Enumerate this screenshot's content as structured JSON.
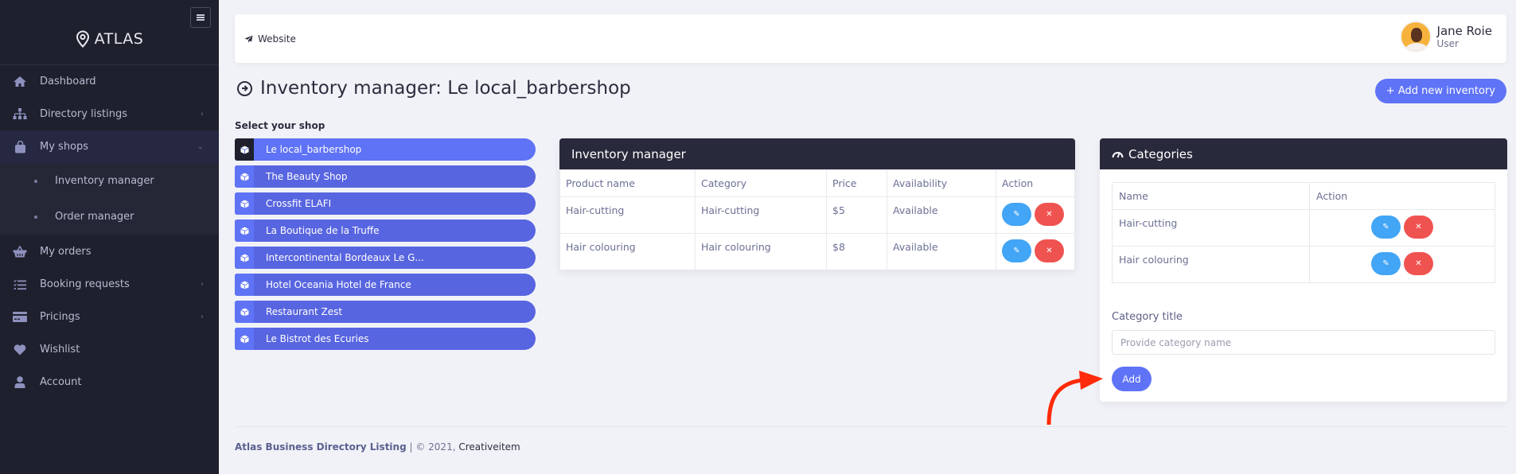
{
  "sidebar": {
    "brand": "ATLAS",
    "menu": [
      {
        "label": "Dashboard",
        "icon": "home-icon"
      },
      {
        "label": "Directory listings",
        "icon": "sitemap-icon"
      },
      {
        "label": "My shops",
        "icon": "shopping-bag-icon"
      },
      {
        "label": "My orders",
        "icon": "basket-icon"
      },
      {
        "label": "Booking requests",
        "icon": "tasks-icon"
      },
      {
        "label": "Pricings",
        "icon": "credit-card-icon"
      },
      {
        "label": "Wishlist",
        "icon": "heart-icon"
      },
      {
        "label": "Account",
        "icon": "user-icon"
      }
    ],
    "submenu": [
      {
        "label": "Inventory manager"
      },
      {
        "label": "Order manager"
      }
    ]
  },
  "topbar": {
    "website_label": "Website",
    "user_name": "Jane Roie",
    "user_role": "User"
  },
  "page": {
    "title": "Inventory manager: Le local_barbershop",
    "add_inventory_label": "+ Add new inventory",
    "select_shop_label": "Select your shop"
  },
  "shops": [
    {
      "name": "Le local_barbershop",
      "active": true
    },
    {
      "name": "The Beauty Shop"
    },
    {
      "name": "Crossfit ELAFI"
    },
    {
      "name": "La Boutique de la Truffe"
    },
    {
      "name": "Intercontinental Bordeaux Le G..."
    },
    {
      "name": "Hotel Oceania Hotel de France"
    },
    {
      "name": "Restaurant Zest"
    },
    {
      "name": "Le Bistrot des Ecuries"
    }
  ],
  "inventory": {
    "title": "Inventory manager",
    "columns": [
      "Product name",
      "Category",
      "Price",
      "Availability",
      "Action"
    ],
    "rows": [
      {
        "product": "Hair-cutting",
        "category": "Hair-cutting",
        "price": "$5",
        "availability": "Available"
      },
      {
        "product": "Hair colouring",
        "category": "Hair colouring",
        "price": "$8",
        "availability": "Available"
      }
    ]
  },
  "categories": {
    "title": "Categories",
    "columns": [
      "Name",
      "Action"
    ],
    "rows": [
      {
        "name": "Hair-cutting"
      },
      {
        "name": "Hair colouring"
      }
    ],
    "field_label": "Category title",
    "input_value": "",
    "input_placeholder": "Provide category name",
    "add_label": "Add"
  },
  "footer": {
    "brand": "Atlas Business Directory Listing",
    "separator": " | ",
    "copyright": "© 2021, ",
    "company": "Creativeitem"
  },
  "icons": {
    "edit": "✎",
    "delete": "✕"
  },
  "colors": {
    "accent": "#5f73f6",
    "shop_item": "#5865e0",
    "sidebar_bg": "#1e202d",
    "panel_header": "#282a3b",
    "edit_button": "#42a5f5",
    "delete_button": "#ef5350",
    "annotation_arrow": "#ff2a0a"
  }
}
